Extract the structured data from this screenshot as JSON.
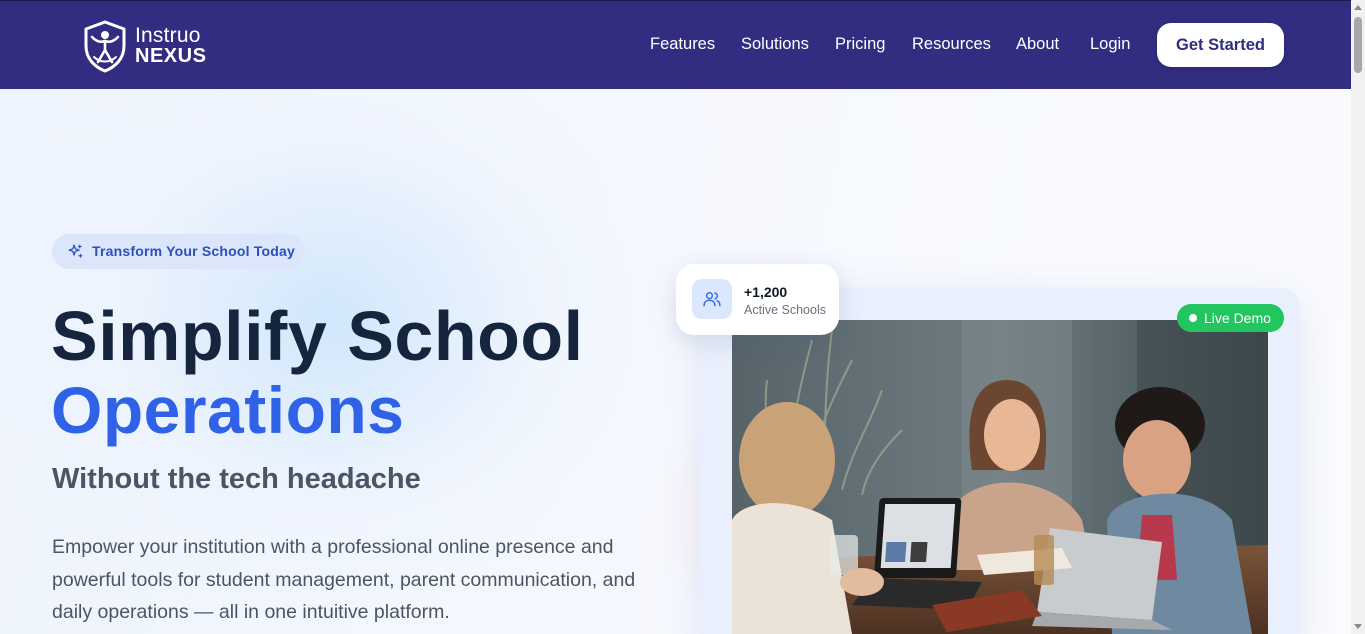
{
  "brand": {
    "name_line1": "Instruo",
    "name_line2": "NEXUS",
    "logo_icon": "shield-person-icon"
  },
  "nav": {
    "items": [
      {
        "label": "Features"
      },
      {
        "label": "Solutions"
      },
      {
        "label": "Pricing"
      },
      {
        "label": "Resources"
      },
      {
        "label": "About"
      },
      {
        "label": "Login"
      }
    ],
    "cta": "Get Started"
  },
  "hero": {
    "badge": {
      "icon": "sparkles-icon",
      "text": "Transform Your School Today"
    },
    "headline_line1": "Simplify School",
    "headline_line2": "Operations",
    "subheadline": "Without the tech headache",
    "body": "Empower your institution with a professional online presence and powerful tools for student management, parent communication, and daily operations — all in one intuitive platform."
  },
  "showcase": {
    "live_badge": "Live Demo",
    "stat": {
      "icon": "users-icon",
      "value": "+1,200",
      "label": "Active Schools"
    },
    "photo": "students-working-around-table-with-laptops"
  },
  "colors": {
    "header_bg": "#322d80",
    "headline": "#15253e",
    "accent_blue": "#2f62e6",
    "live_green": "#22c55e",
    "badge_bg": "#dbe6fb"
  }
}
